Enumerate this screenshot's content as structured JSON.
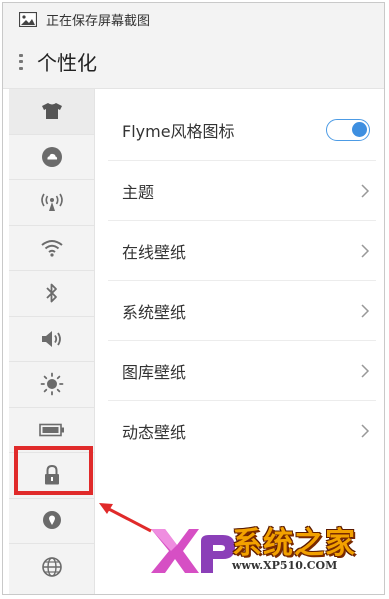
{
  "status_bar": {
    "text": "正在保存屏幕截图",
    "icon": "image-icon"
  },
  "header": {
    "title": "个性化",
    "icon": "drag-handle-icon"
  },
  "rail": {
    "items": [
      {
        "name": "theme-shirt-icon",
        "active": true
      },
      {
        "name": "cloud-icon"
      },
      {
        "name": "hotspot-icon"
      },
      {
        "name": "wifi-icon"
      },
      {
        "name": "bluetooth-icon"
      },
      {
        "name": "sound-icon"
      },
      {
        "name": "brightness-icon"
      },
      {
        "name": "battery-icon"
      },
      {
        "name": "lock-icon",
        "highlighted": true
      },
      {
        "name": "location-icon"
      },
      {
        "name": "globe-icon"
      }
    ]
  },
  "settings": {
    "rows": [
      {
        "label": "Flyme风格图标",
        "control": "toggle",
        "toggle_on": true
      },
      {
        "label": "主题",
        "control": "chevron"
      },
      {
        "label": "在线壁纸",
        "control": "chevron"
      },
      {
        "label": "系统壁纸",
        "control": "chevron"
      },
      {
        "label": "图库壁纸",
        "control": "chevron"
      },
      {
        "label": "动态壁纸",
        "control": "chevron"
      }
    ]
  },
  "watermark": {
    "brand": "系统之家",
    "url": "www.XP510.COM"
  },
  "colors": {
    "accent": "#3e8fe0",
    "highlight": "#e02a2a",
    "rail_bg": "#f3f3f3",
    "icon": "#6b6b6b"
  }
}
